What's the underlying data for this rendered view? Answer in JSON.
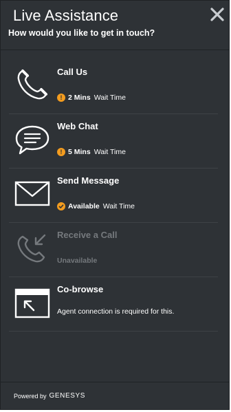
{
  "header": {
    "title": "Live Assistance",
    "subtitle": "How would you like to get in touch?"
  },
  "options": [
    {
      "name": "Call Us",
      "status_value": "2 Mins",
      "status_label": "Wait Time",
      "icon": "phone-icon",
      "badge": "warning-icon"
    },
    {
      "name": "Web Chat",
      "status_value": "5 Mins",
      "status_label": "Wait Time",
      "icon": "chat-bubble-icon",
      "badge": "warning-icon"
    },
    {
      "name": "Send Message",
      "status_value": "Available",
      "status_label": "Wait Time",
      "icon": "envelope-icon",
      "badge": "checkmark-icon"
    },
    {
      "name": "Receive a Call",
      "status_value": "Unavailable",
      "icon": "incoming-call-icon",
      "disabled": true
    },
    {
      "name": "Co-browse",
      "note": "Agent connection is required for this.",
      "icon": "cobrowse-icon"
    }
  ],
  "footer": {
    "powered_by": "Powered by",
    "brand": "GENESYS"
  },
  "colors": {
    "background": "#2e3236",
    "text": "#ffffff",
    "muted": "#75797d",
    "badge": "#f39c1f"
  }
}
